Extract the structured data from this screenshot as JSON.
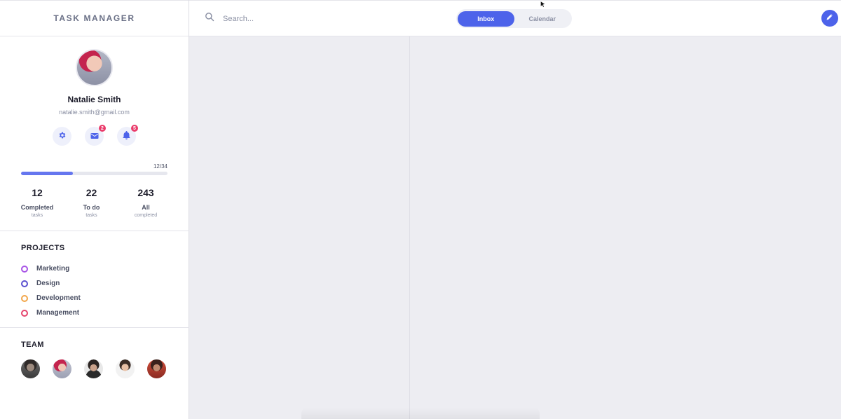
{
  "app": {
    "brand": "TASK MANAGER"
  },
  "user": {
    "name": "Natalie Smith",
    "email": "natalie.smith@gmail.com"
  },
  "actions": {
    "settings_icon": "gear-icon",
    "mail_icon": "envelope-icon",
    "mail_badge": "2",
    "notifications_icon": "bell-icon",
    "notifications_badge": "5"
  },
  "progress": {
    "label": "12/34",
    "completed": 12,
    "total": 34
  },
  "stats": [
    {
      "value": "12",
      "label": "Completed",
      "sub": "tasks"
    },
    {
      "value": "22",
      "label": "To do",
      "sub": "tasks"
    },
    {
      "value": "243",
      "label": "All",
      "sub": "completed"
    }
  ],
  "projects": {
    "title": "PROJECTS",
    "items": [
      {
        "label": "Marketing",
        "color": "#a855e6"
      },
      {
        "label": "Design",
        "color": "#5a4fcf"
      },
      {
        "label": "Development",
        "color": "#f2a64a"
      },
      {
        "label": "Management",
        "color": "#e5436b"
      }
    ]
  },
  "team": {
    "title": "TEAM",
    "members_count": 5
  },
  "topbar": {
    "search_placeholder": "Search...",
    "tabs": [
      {
        "label": "Inbox",
        "active": true
      },
      {
        "label": "Calendar",
        "active": false
      }
    ],
    "compose_icon": "pencil-icon"
  },
  "colors": {
    "accent": "#4d63ea",
    "badge": "#ea3b6a",
    "background": "#ededf2"
  }
}
